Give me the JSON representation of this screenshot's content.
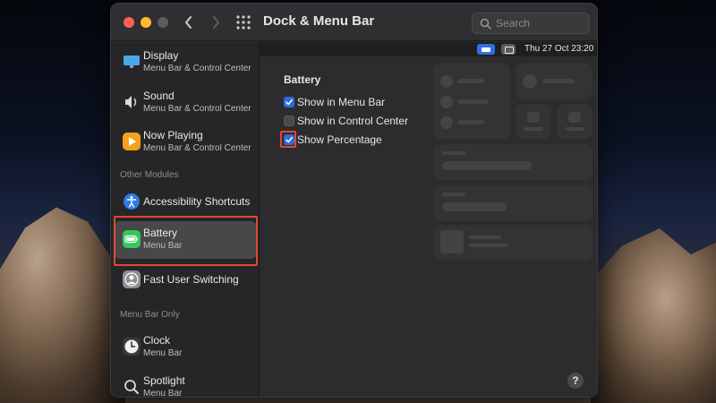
{
  "window": {
    "title": "Dock & Menu Bar",
    "search_placeholder": "Search"
  },
  "menubar_preview": {
    "clock": "Thu 27 Oct  23:20"
  },
  "sidebar": {
    "items_top": [
      {
        "label": "Display",
        "sub": "Menu Bar & Control Center"
      },
      {
        "label": "Sound",
        "sub": "Menu Bar & Control Center"
      },
      {
        "label": "Now Playing",
        "sub": "Menu Bar & Control Center"
      }
    ],
    "other_modules_header": "Other Modules",
    "other_modules": [
      {
        "label": "Accessibility Shortcuts"
      },
      {
        "label": "Battery",
        "sub": "Menu Bar",
        "selected": true
      },
      {
        "label": "Fast User Switching"
      }
    ],
    "menu_bar_only_header": "Menu Bar Only",
    "menu_bar_only": [
      {
        "label": "Clock",
        "sub": "Menu Bar"
      },
      {
        "label": "Spotlight",
        "sub": "Menu Bar"
      }
    ]
  },
  "battery_settings": {
    "title": "Battery",
    "options": [
      {
        "label": "Show in Menu Bar",
        "checked": true
      },
      {
        "label": "Show in Control Center",
        "checked": false
      },
      {
        "label": "Show Percentage",
        "checked": true
      }
    ]
  },
  "help_label": "?",
  "colors": {
    "accent": "#2e6be0",
    "highlight": "#e04a2f",
    "battery_icon": "#35c759"
  }
}
